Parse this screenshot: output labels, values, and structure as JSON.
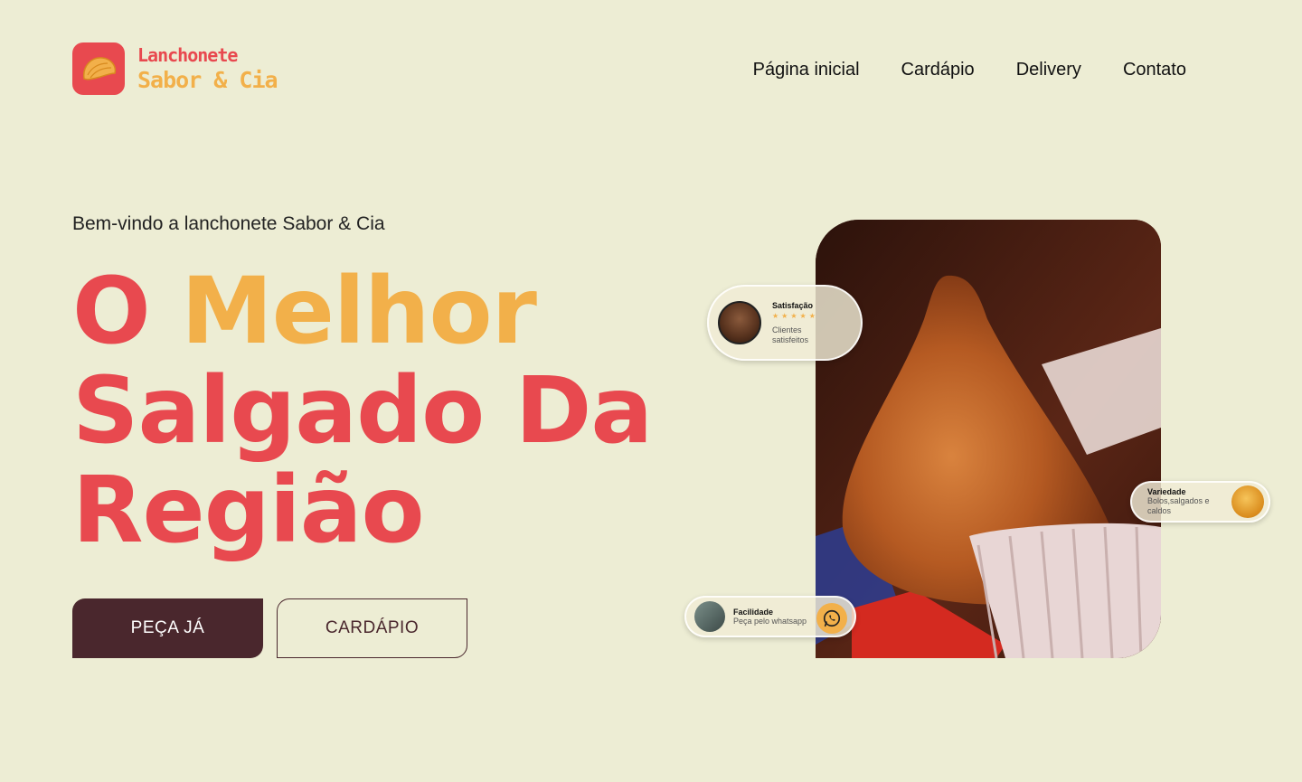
{
  "brand": {
    "line1": "Lanchonete",
    "line2": "Sabor & Cia",
    "colors": {
      "red": "#E8494F",
      "yellow": "#F2B04A",
      "dark": "#4A272D",
      "bg": "#EDEDD4"
    }
  },
  "nav": {
    "items": [
      {
        "label": "Página inicial"
      },
      {
        "label": "Cardápio"
      },
      {
        "label": "Delivery"
      },
      {
        "label": "Contato"
      }
    ]
  },
  "hero": {
    "welcome": "Bem-vindo a lanchonete Sabor & Cia",
    "headline_word1": "O",
    "headline_word2": "Melhor",
    "headline_line2": "Salgado Da",
    "headline_line3": "Região",
    "primary_button": "PEÇA JÁ",
    "secondary_button": "CARDÁPIO"
  },
  "badges": {
    "satisfaction": {
      "title": "Satisfação",
      "stars": "★★★★★",
      "subtitle": "Clientes satisfeitos"
    },
    "variety": {
      "title": "Variedade",
      "subtitle": "Bolos,salgados e caldos"
    },
    "ease": {
      "title": "Facilidade",
      "subtitle": "Peça pelo whatsapp"
    }
  },
  "icons": [
    "logo-pastel-icon",
    "whatsapp-icon",
    "avatar",
    "coxinha-photo"
  ]
}
